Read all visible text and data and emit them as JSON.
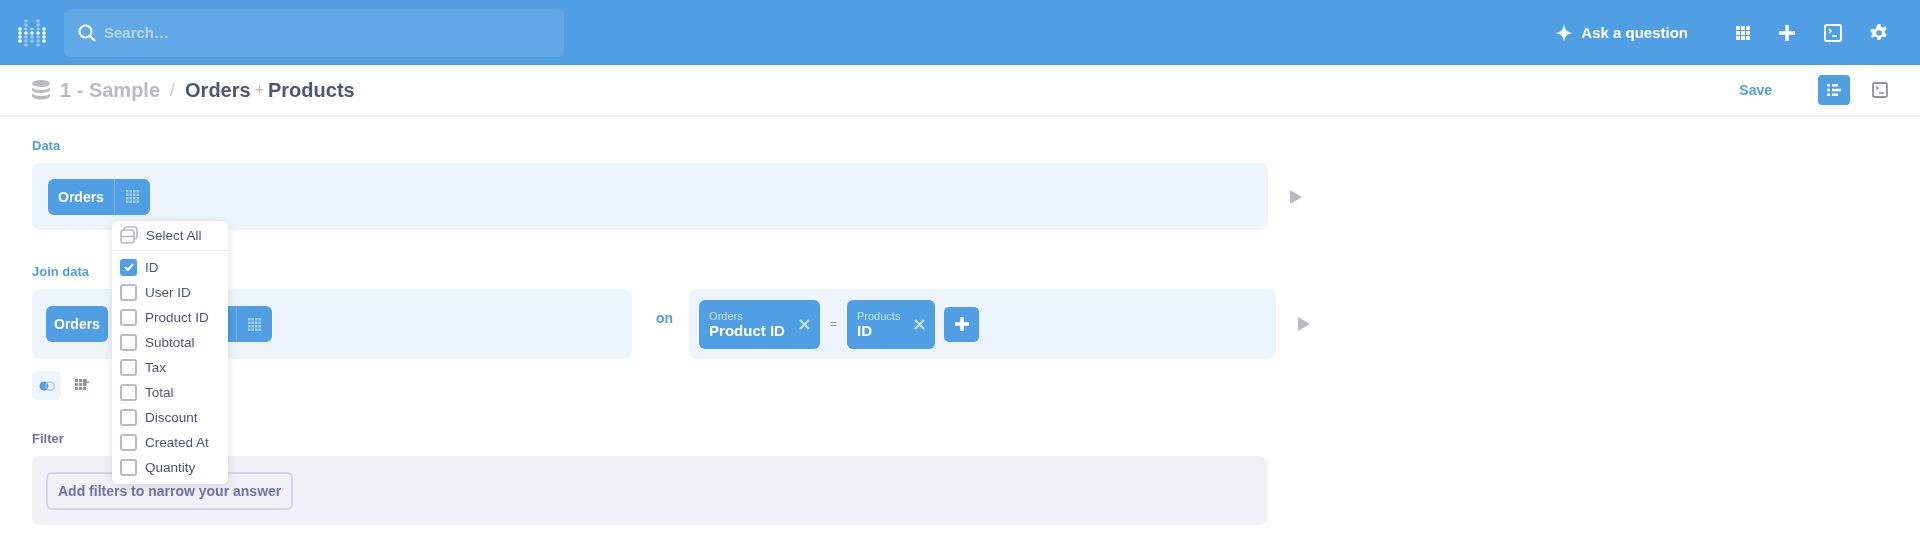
{
  "top_bar": {
    "search": {
      "placeholder": "Search…"
    },
    "ask_button": "Ask a question"
  },
  "breadcrumb": {
    "database": "1 - Sample",
    "separator": "/",
    "first_table": "Orders",
    "joiner": "+",
    "second_table": "Products"
  },
  "header_actions": {
    "save": "Save",
    "notebook_selected": true
  },
  "data_section": {
    "label": "Data",
    "table": "Orders"
  },
  "column_picker": {
    "select_all": "Select All",
    "columns": [
      {
        "label": "ID",
        "checked": true
      },
      {
        "label": "User ID",
        "checked": false
      },
      {
        "label": "Product ID",
        "checked": false
      },
      {
        "label": "Subtotal",
        "checked": false
      },
      {
        "label": "Tax",
        "checked": false
      },
      {
        "label": "Total",
        "checked": false
      },
      {
        "label": "Discount",
        "checked": false
      },
      {
        "label": "Created At",
        "checked": false
      },
      {
        "label": "Quantity",
        "checked": false
      }
    ]
  },
  "join_section": {
    "label": "Join data",
    "left_table": "Orders",
    "on": "on",
    "operator": "=",
    "conditions": [
      {
        "table": "Orders",
        "column": "Product ID"
      },
      {
        "table": "Products",
        "column": "ID"
      }
    ]
  },
  "filter_section": {
    "label": "Filter",
    "button": "Add filters to narrow your answer"
  }
}
